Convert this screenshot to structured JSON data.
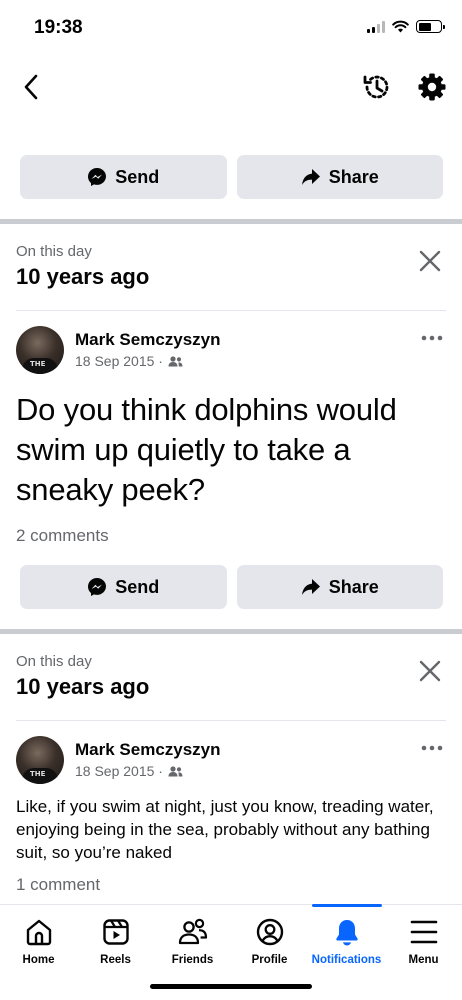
{
  "status_bar": {
    "time": "19:38"
  },
  "nav": {
    "back_icon": "chevron-left-icon",
    "history_icon": "history-icon",
    "settings_icon": "gear-icon"
  },
  "top_actions": {
    "send_label": "Send",
    "share_label": "Share"
  },
  "memories": [
    {
      "label": "On this day",
      "title": "10 years ago",
      "author": "Mark Semczyszyn",
      "date": "18 Sep 2015 ·",
      "audience_icon": "friends-icon",
      "text": "Do you think dolphins would swim up quietly to take a sneaky peek?",
      "comments": "2 comments",
      "send_label": "Send",
      "share_label": "Share"
    },
    {
      "label": "On this day",
      "title": "10 years ago",
      "author": "Mark Semczyszyn",
      "date": "18 Sep 2015 ·",
      "audience_icon": "friends-icon",
      "text": "Like, if you swim at night, just you know, treading water, enjoying being in the sea, probably without any bathing suit, so you’re naked",
      "comments": "1 comment"
    }
  ],
  "tab_bar": {
    "active": "Notifications",
    "accent_color": "#0866ff",
    "tabs": [
      {
        "label": "Home",
        "icon": "home-icon"
      },
      {
        "label": "Reels",
        "icon": "reels-icon"
      },
      {
        "label": "Friends",
        "icon": "friends-icon"
      },
      {
        "label": "Profile",
        "icon": "profile-icon"
      },
      {
        "label": "Notifications",
        "icon": "bell-icon"
      },
      {
        "label": "Menu",
        "icon": "menu-icon"
      }
    ]
  }
}
